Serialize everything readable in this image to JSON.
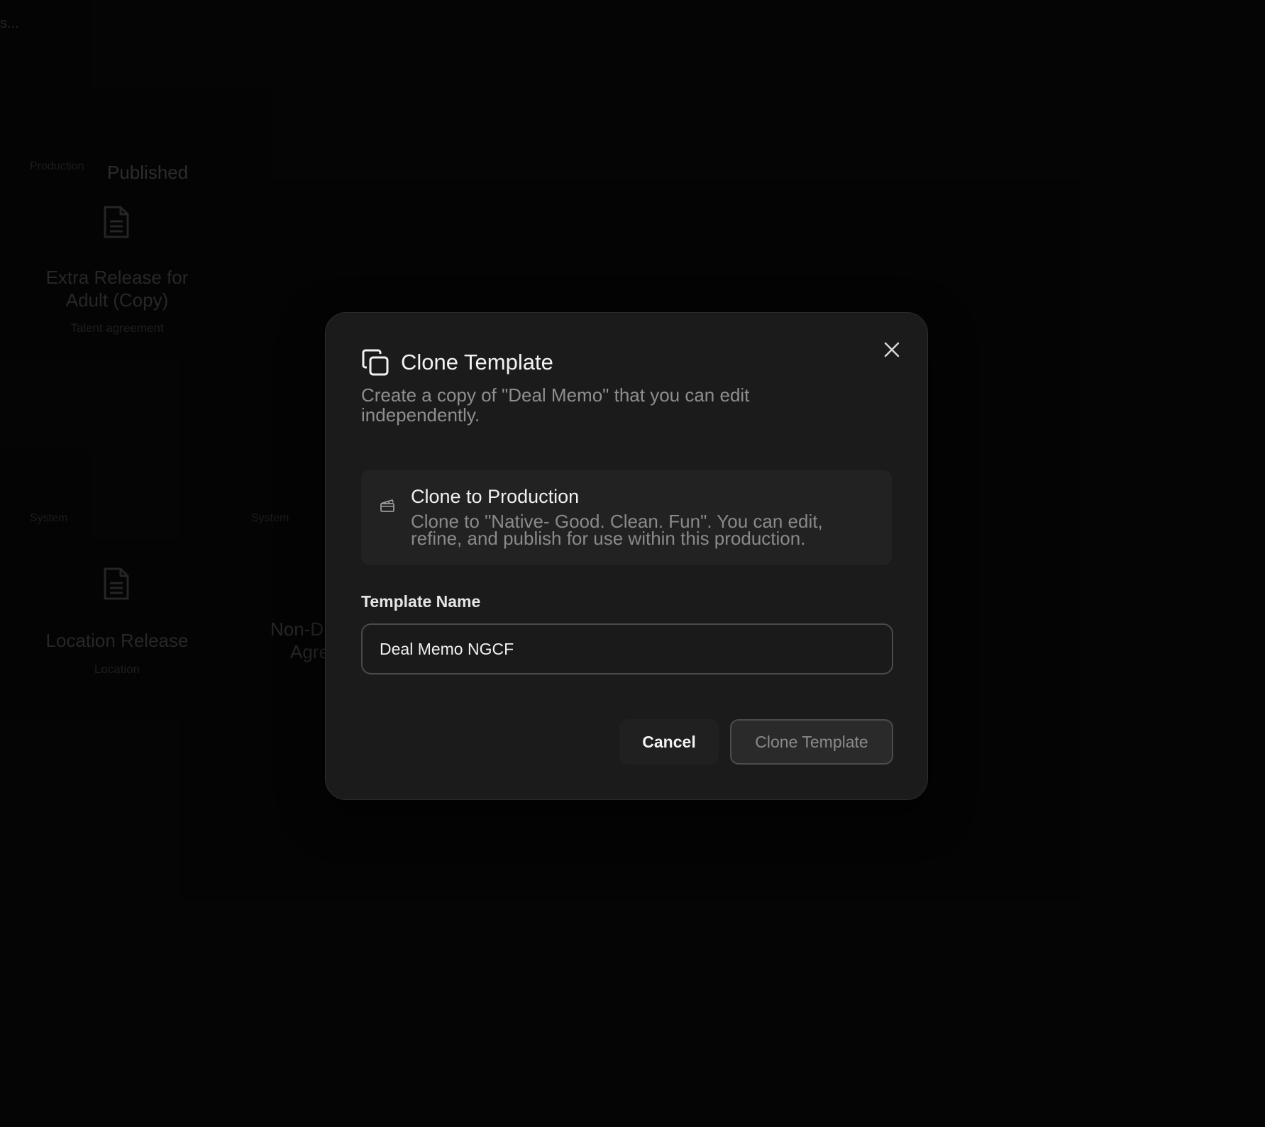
{
  "background": {
    "loading_text": "s...",
    "cards": [
      {
        "tag": "Production",
        "status": "Published",
        "title": "Extra Release for Adult (Copy)",
        "subtitle": "Talent agreement",
        "icon": "document-icon"
      },
      {
        "tag": "System",
        "title": "Location Release",
        "subtitle": "Location",
        "icon": "document-icon"
      },
      {
        "tag": "System",
        "title_partial_line1": "Non-D",
        "title_partial_line2": "Agre"
      }
    ]
  },
  "dialog": {
    "title": "Clone Template",
    "header_icon": "copy-icon",
    "description": "Create a copy of \"Deal Memo\" that you can edit independently.",
    "close_icon": "close-icon",
    "option": {
      "icon": "clapperboard-icon",
      "title": "Clone to Production",
      "description": "Clone to \"Native- Good. Clean. Fun\". You can edit, refine, and publish for use within this production."
    },
    "field": {
      "label": "Template Name",
      "value": "Deal Memo NGCF"
    },
    "buttons": {
      "cancel": "Cancel",
      "confirm": "Clone Template"
    }
  }
}
